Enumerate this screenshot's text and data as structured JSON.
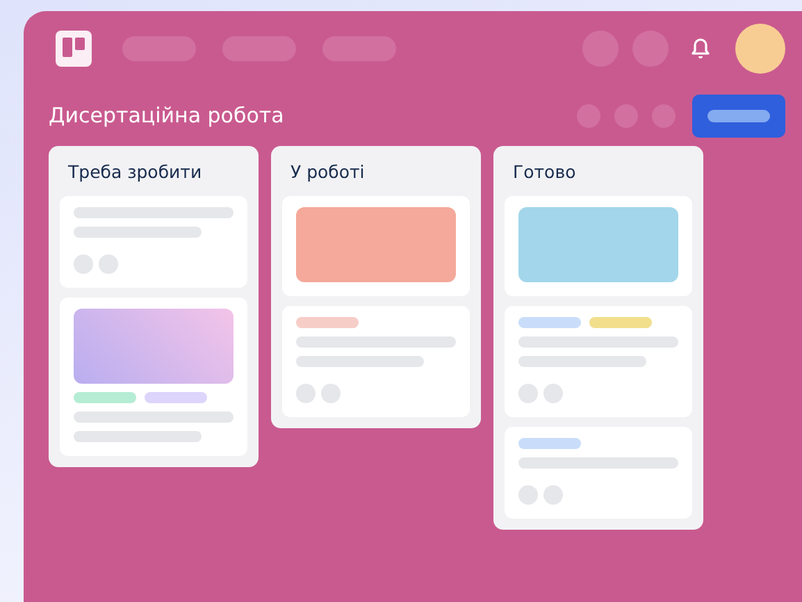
{
  "board": {
    "title": "Дисертаційна робота"
  },
  "lists": [
    {
      "title": "Треба зробити",
      "cards": [
        {
          "kind": "task"
        },
        {
          "kind": "cover",
          "cover": {
            "color": "#b9aef0"
          },
          "labels": [
            {
              "color": "#b5ecd4"
            },
            {
              "color": "#ddd5fb"
            }
          ]
        }
      ]
    },
    {
      "title": "У роботі",
      "cards": [
        {
          "kind": "image",
          "cover": {
            "color": "#f4a99a"
          }
        },
        {
          "kind": "task",
          "labels": [
            {
              "color": "#f7cdc8"
            }
          ]
        }
      ]
    },
    {
      "title": "Готово",
      "cards": [
        {
          "kind": "image",
          "cover": {
            "color": "#a3d6ea"
          }
        },
        {
          "kind": "task",
          "labels": [
            {
              "color": "#c9ddfa"
            },
            {
              "color": "#f2df8c"
            }
          ]
        },
        {
          "kind": "note",
          "labels": [
            {
              "color": "#c9ddfa"
            }
          ]
        }
      ]
    }
  ]
}
